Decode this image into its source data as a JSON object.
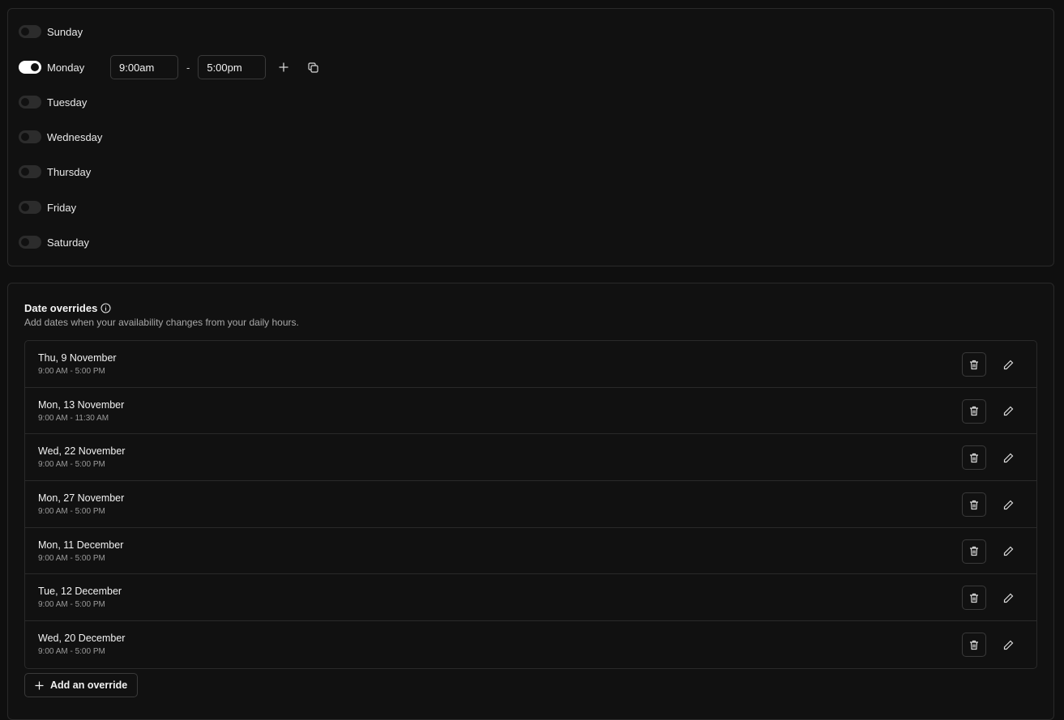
{
  "weekly": {
    "days": [
      {
        "label": "Sunday",
        "enabled": false
      },
      {
        "label": "Monday",
        "enabled": true,
        "start": "9:00am",
        "end": "5:00pm"
      },
      {
        "label": "Tuesday",
        "enabled": false
      },
      {
        "label": "Wednesday",
        "enabled": false
      },
      {
        "label": "Thursday",
        "enabled": false
      },
      {
        "label": "Friday",
        "enabled": false
      },
      {
        "label": "Saturday",
        "enabled": false
      }
    ],
    "range_separator": "-",
    "icons": {
      "add": "plus-icon",
      "copy": "copy-icon"
    }
  },
  "overrides": {
    "title": "Date overrides",
    "subtitle": "Add dates when your availability changes from your daily hours.",
    "items": [
      {
        "date": "Thu, 9 November",
        "time": "9:00 AM - 5:00 PM"
      },
      {
        "date": "Mon, 13 November",
        "time": "9:00 AM - 11:30 AM"
      },
      {
        "date": "Wed, 22 November",
        "time": "9:00 AM - 5:00 PM"
      },
      {
        "date": "Mon, 27 November",
        "time": "9:00 AM - 5:00 PM"
      },
      {
        "date": "Mon, 11 December",
        "time": "9:00 AM - 5:00 PM"
      },
      {
        "date": "Tue, 12 December",
        "time": "9:00 AM - 5:00 PM"
      },
      {
        "date": "Wed, 20 December",
        "time": "9:00 AM - 5:00 PM"
      }
    ],
    "add_label": "Add an override"
  },
  "colors": {
    "background": "#0f0f0f",
    "card": "#111111",
    "border": "#2a2a2a",
    "toggle_on": "#ffffff"
  }
}
